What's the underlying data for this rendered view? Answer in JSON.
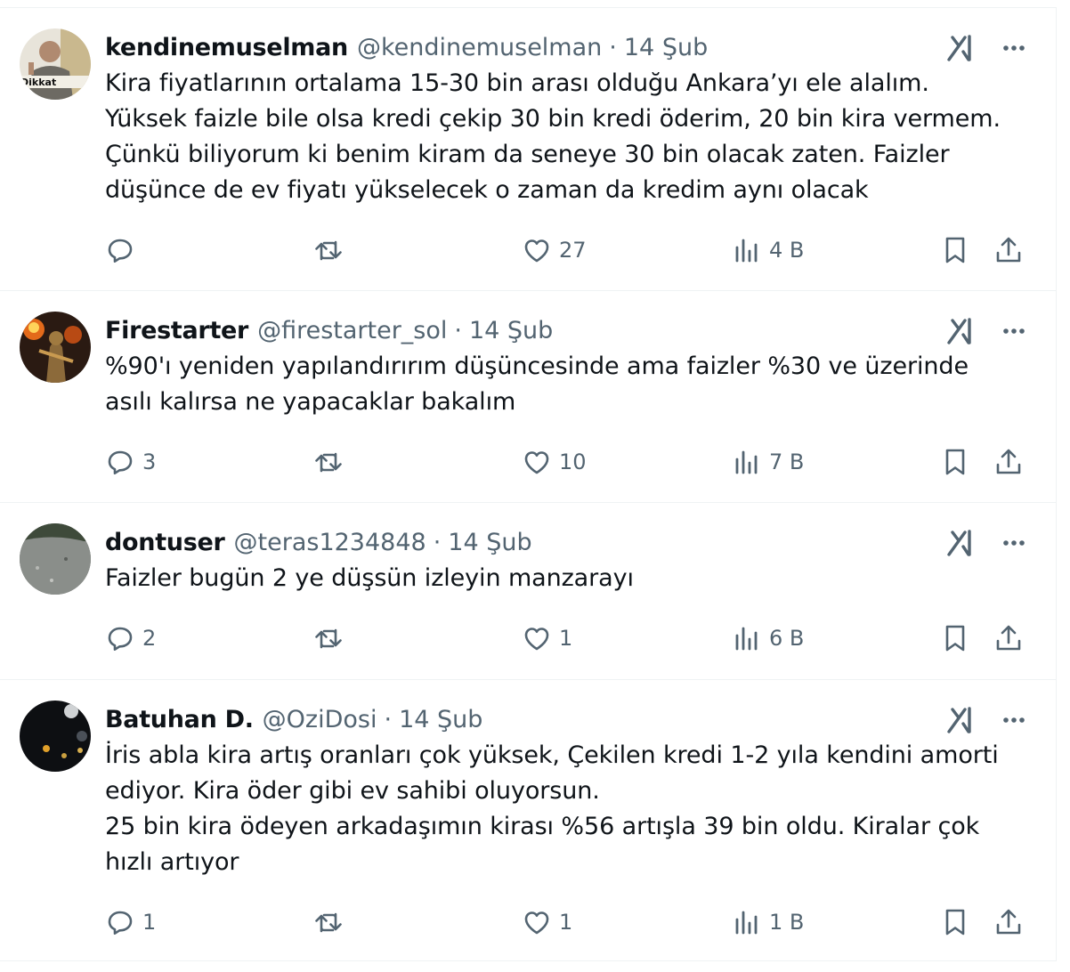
{
  "tweets": [
    {
      "name": "kendinemuselman",
      "handle": "@kendinemuselman",
      "dot": "·",
      "time": "14 Şub",
      "text": "Kira fiyatlarının ortalama 15-30 bin arası olduğu Ankara’yı ele alalım.\nYüksek faizle bile olsa kredi çekip 30 bin kredi öderim, 20 bin kira vermem.\nÇünkü biliyorum ki benim kiram da seneye 30 bin olacak zaten. Faizler\ndüşünce de ev fiyatı yükselecek o zaman da kredim aynı olacak",
      "replies": "",
      "retweets": "",
      "likes": "27",
      "views": "4 B",
      "avatar_text": "Dikkat"
    },
    {
      "name": "Firestarter",
      "handle": "@firestarter_sol",
      "dot": "·",
      "time": "14 Şub",
      "text": "%90'ı yeniden yapılandırırım düşüncesinde ama faizler %30 ve üzerinde\nasılı kalırsa ne yapacaklar bakalım",
      "replies": "3",
      "retweets": "",
      "likes": "10",
      "views": "7 B"
    },
    {
      "name": "dontuser",
      "handle": "@teras1234848",
      "dot": "·",
      "time": "14 Şub",
      "text": "Faizler bugün 2 ye düşsün izleyin manzarayı",
      "replies": "2",
      "retweets": "",
      "likes": "1",
      "views": "6 B"
    },
    {
      "name": "Batuhan D.",
      "handle": "@OziDosi",
      "dot": "·",
      "time": "14 Şub",
      "text": "İris abla kira artış oranları çok yüksek, Çekilen kredi 1-2 yıla kendini amorti\nediyor. Kira öder gibi ev sahibi oluyorsun.\n25 bin kira ödeyen arkadaşımın kirası %56 artışla 39 bin oldu. Kiralar çok\nhızlı artıyor",
      "replies": "1",
      "retweets": "",
      "likes": "1",
      "views": "1 B"
    }
  ],
  "icons": {
    "reply": "reply-icon",
    "retweet": "retweet-icon",
    "like": "heart-icon",
    "views": "views-icon",
    "bookmark": "bookmark-icon",
    "share": "share-icon",
    "grok": "grok-icon",
    "more": "more-icon"
  },
  "colors": {
    "text": "#0f1419",
    "secondary": "#536471",
    "border": "#eff3f4"
  }
}
